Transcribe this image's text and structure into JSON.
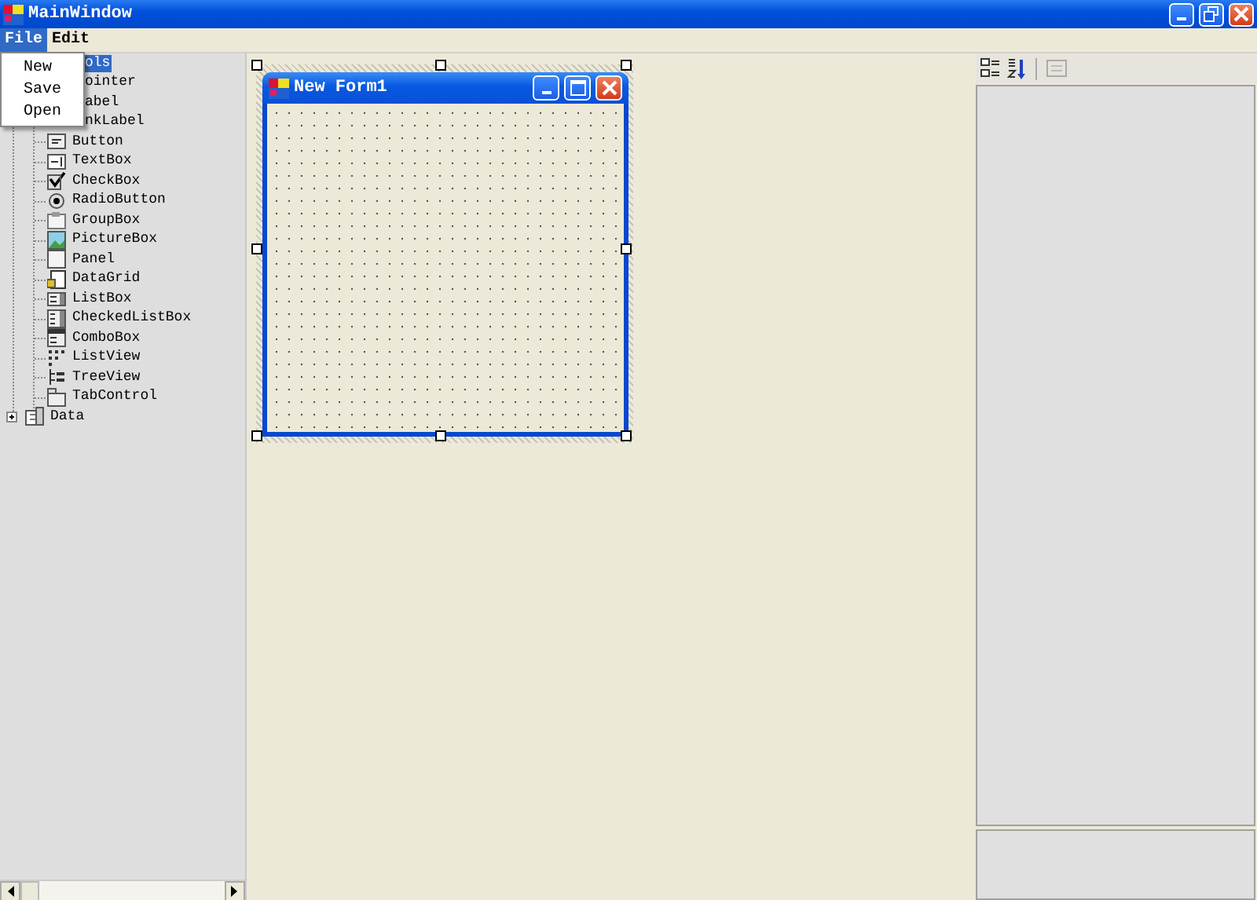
{
  "window": {
    "title": "MainWindow"
  },
  "menu_bar": [
    {
      "label": "File",
      "selected": true
    },
    {
      "label": "Edit",
      "selected": false
    }
  ],
  "open_menu": {
    "items": [
      "New",
      "Save",
      "Open"
    ]
  },
  "toolbox": {
    "items": [
      {
        "label": "ols",
        "selected": true,
        "expanded": true,
        "children": [
          {
            "label": "ointer",
            "selected": false
          },
          {
            "label": "abel",
            "selected": false
          },
          {
            "label": "nkLabel",
            "selected": false
          },
          {
            "label": "Button",
            "selected": false
          },
          {
            "label": "TextBox",
            "selected": false
          },
          {
            "label": "CheckBox",
            "selected": false
          },
          {
            "label": "RadioButton",
            "selected": false
          },
          {
            "label": "GroupBox",
            "selected": false
          },
          {
            "label": "PictureBox",
            "selected": false
          },
          {
            "label": "Panel",
            "selected": false
          },
          {
            "label": "DataGrid",
            "selected": false
          },
          {
            "label": "ListBox",
            "selected": false
          },
          {
            "label": "CheckedListBox",
            "selected": false
          },
          {
            "label": "ComboBox",
            "selected": false
          },
          {
            "label": "ListView",
            "selected": false
          },
          {
            "label": "TreeView",
            "selected": false
          },
          {
            "label": "TabControl",
            "selected": false
          }
        ]
      },
      {
        "label": "Data",
        "selected": false,
        "expanded": false
      }
    ]
  },
  "designer": {
    "form_title": "New Form1"
  }
}
